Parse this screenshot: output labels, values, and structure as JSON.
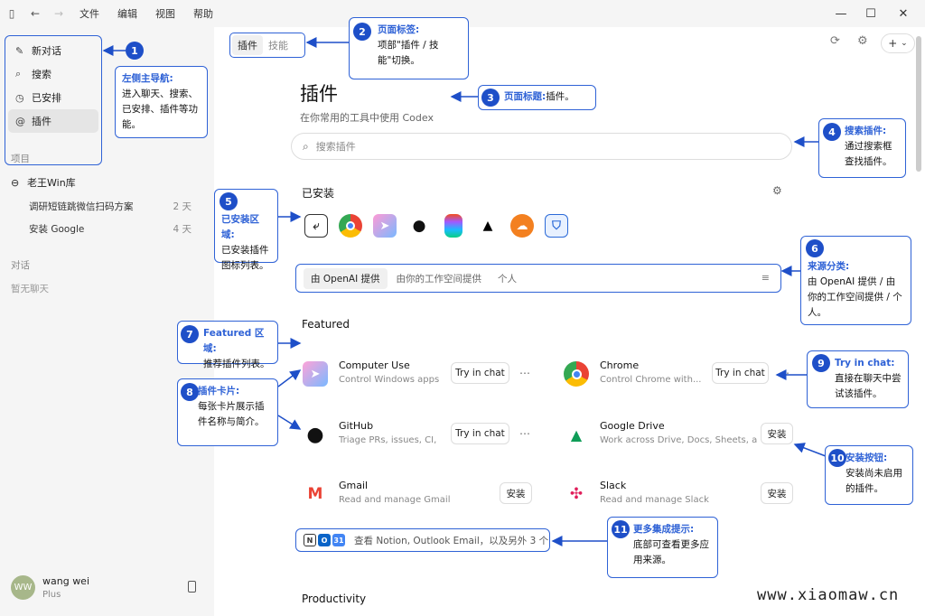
{
  "menu": [
    "文件",
    "编辑",
    "视图",
    "帮助"
  ],
  "sidebar": {
    "nav": [
      {
        "label": "新对话",
        "icon": "edit-icon"
      },
      {
        "label": "搜索",
        "icon": "search-icon"
      },
      {
        "label": "已安排",
        "icon": "clock-icon"
      },
      {
        "label": "插件",
        "icon": "plugin-icon",
        "active": true
      }
    ],
    "projects_label": "项目",
    "project_name": "老王Win库",
    "chats": [
      {
        "title": "调研短链跳微信扫码方案",
        "age": "2 天"
      },
      {
        "title": "安装 Google",
        "age": "4 天"
      }
    ],
    "conversations_label": "对话",
    "no_chats": "暂无聊天",
    "user": {
      "initials": "WW",
      "name": "wang wei",
      "plan": "Plus"
    }
  },
  "main": {
    "tabs": [
      {
        "label": "插件",
        "active": true
      },
      {
        "label": "技能",
        "active": false
      }
    ],
    "title": "插件",
    "subtitle": "在你常用的工具中使用 Codex",
    "search_placeholder": "搜索插件",
    "installed_label": "已安装",
    "installed_icons": [
      "computer-use",
      "chrome",
      "codex",
      "github",
      "figma",
      "vercel",
      "cloudflare",
      "shield"
    ],
    "filters": [
      {
        "label": "由 OpenAI 提供",
        "active": true
      },
      {
        "label": "由你的工作空间提供",
        "active": false
      },
      {
        "label": "个人",
        "active": false
      }
    ],
    "featured_label": "Featured",
    "cards": [
      {
        "name": "Computer Use",
        "desc": "Control Windows apps...",
        "button": "Try in chat",
        "more": true,
        "logo": "computer-use"
      },
      {
        "name": "Chrome",
        "desc": "Control Chrome with...",
        "button": "Try in chat",
        "more": true,
        "logo": "chrome"
      },
      {
        "name": "GitHub",
        "desc": "Triage PRs, issues, CI, an...",
        "button": "Try in chat",
        "more": true,
        "logo": "github"
      },
      {
        "name": "Google Drive",
        "desc": "Work across Drive, Docs, Sheets, and...",
        "button": "安装",
        "more": false,
        "logo": "google-drive"
      },
      {
        "name": "Gmail",
        "desc": "Read and manage Gmail",
        "button": "安装",
        "more": false,
        "logo": "gmail"
      },
      {
        "name": "Slack",
        "desc": "Read and manage Slack",
        "button": "安装",
        "more": false,
        "logo": "slack"
      }
    ],
    "more_text": "查看 Notion, Outlook Email，以及另外 3 个",
    "productivity_label": "Productivity"
  },
  "annotations": [
    {
      "n": "1",
      "title": "左侧主导航:",
      "body": "进入聊天、搜索、已安排、插件等功能。"
    },
    {
      "n": "2",
      "title": "页面标签:",
      "body": "项部\"插件 / 技能\"切换。"
    },
    {
      "n": "3",
      "title": "页面标题:",
      "body": "插件。"
    },
    {
      "n": "4",
      "title": "搜索插件:",
      "body": "通过搜索框查找插件。"
    },
    {
      "n": "5",
      "title": "已安装区域:",
      "body": "已安装插件图标列表。"
    },
    {
      "n": "6",
      "title": "来源分类:",
      "body": "由 OpenAI 提供 / 由你的工作空间提供 / 个人。"
    },
    {
      "n": "7",
      "title": "Featured 区域:",
      "body": "推荐插件列表。"
    },
    {
      "n": "8",
      "title": "插件卡片:",
      "body": "每张卡片展示插件名称与简介。"
    },
    {
      "n": "9",
      "title": "Try in chat:",
      "body": "直接在聊天中尝试该插件。"
    },
    {
      "n": "10",
      "title": "安装按钮:",
      "body": "安装尚未启用的插件。"
    },
    {
      "n": "11",
      "title": "更多集成提示:",
      "body": "底部可查看更多应用来源。"
    }
  ],
  "watermark": "www.xiaomaw.cn"
}
